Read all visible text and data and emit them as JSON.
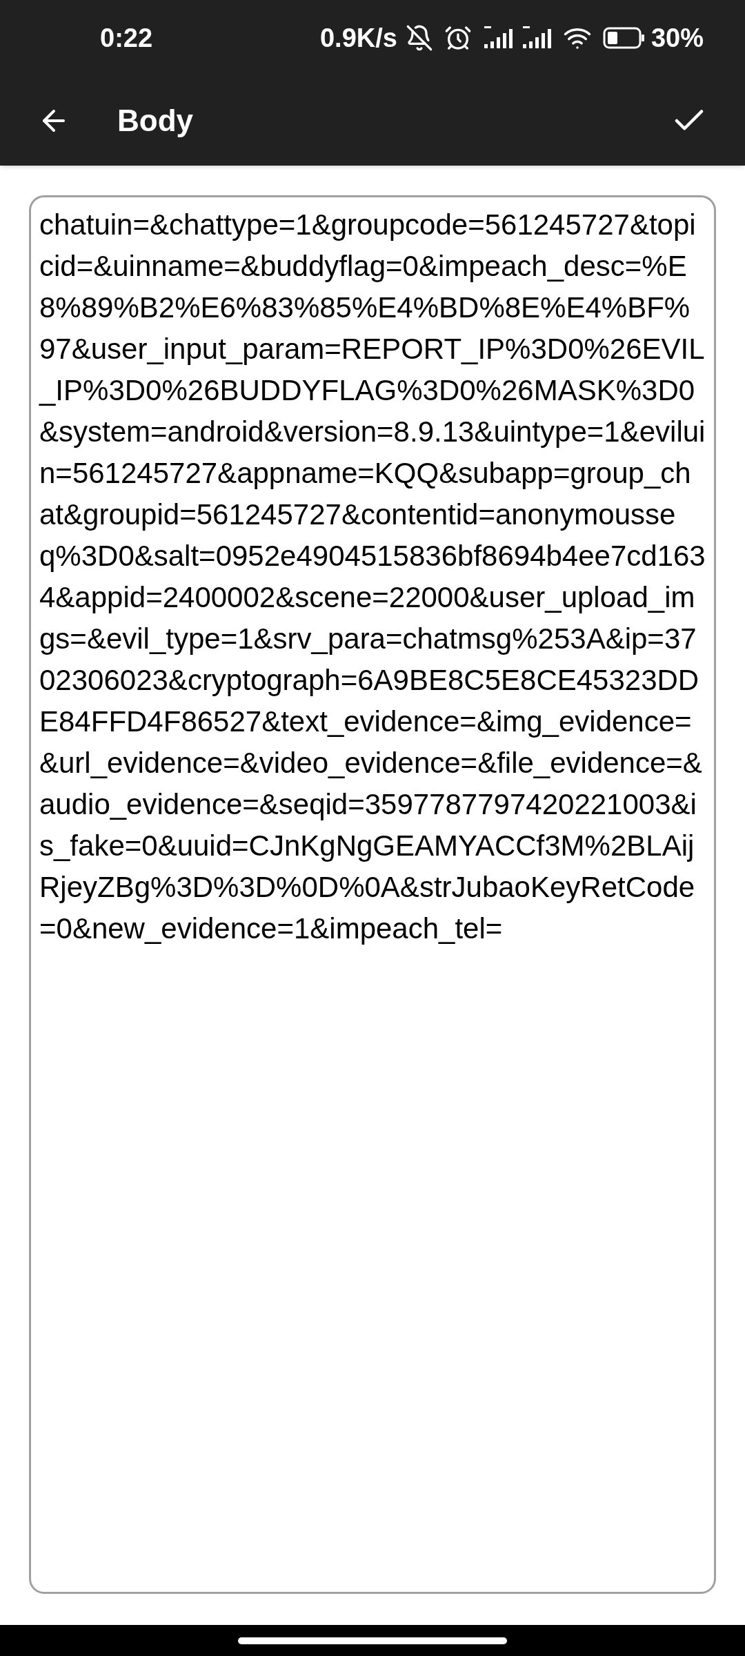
{
  "status_bar": {
    "time": "0:22",
    "speed": "0.9K/s",
    "battery": "30%"
  },
  "app_bar": {
    "title": "Body"
  },
  "body_field": {
    "value": "chatuin=&chattype=1&groupcode=561245727&topicid=&uinname=&buddyflag=0&impeach_desc=%E8%89%B2%E6%83%85%E4%BD%8E%E4%BF%97&user_input_param=REPORT_IP%3D0%26EVIL_IP%3D0%26BUDDYFLAG%3D0%26MASK%3D0&system=android&version=8.9.13&uintype=1&eviluin=561245727&appname=KQQ&subapp=group_chat&groupid=561245727&contentid=anonymousseq%3D0&salt=0952e4904515836bf8694b4ee7cd1634&appid=2400002&scene=22000&user_upload_imgs=&evil_type=1&srv_para=chatmsg%253A&ip=3702306023&cryptograph=6A9BE8C5E8CE45323DDE84FFD4F86527&text_evidence=&img_evidence=&url_evidence=&video_evidence=&file_evidence=&audio_evidence=&seqid=3597787797420221003&is_fake=0&uuid=CJnKgNgGEAMYACCf3M%2BLAijRjeyZBg%3D%3D%0D%0A&strJubaoKeyRetCode=0&new_evidence=1&impeach_tel="
  }
}
